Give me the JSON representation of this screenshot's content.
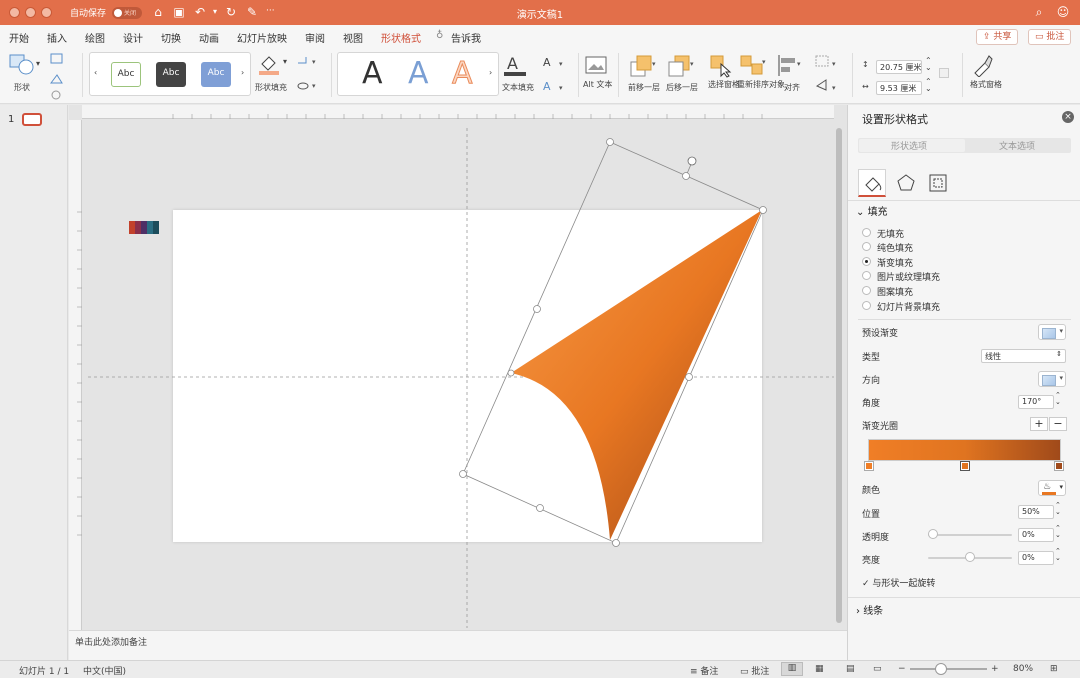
{
  "titlebar": {
    "autosave_label": "自动保存",
    "toggle_label": "关闭",
    "doc_title": "演示文稿1",
    "more": "···"
  },
  "menu": {
    "tabs": [
      "开始",
      "插入",
      "绘图",
      "设计",
      "切换",
      "动画",
      "幻灯片放映",
      "审阅",
      "视图",
      "形状格式",
      "告诉我"
    ],
    "active": "形状格式",
    "share_label": "共享",
    "comment_label": "批注"
  },
  "ribbon": {
    "shape_label": "形状",
    "shape_fill_label": "形状填充",
    "style_samples": [
      "Abc",
      "Abc",
      "Abc"
    ],
    "wordart_samples": [
      "A",
      "A",
      "A"
    ],
    "text_fill_label": "文本填充",
    "alt_text_label": "Alt 文本",
    "bring_forward_label": "前移一层",
    "send_backward_label": "后移一层",
    "selection_pane_label": "选择窗格",
    "reorder_label": "重新排序对象",
    "align_label": "对齐",
    "height_value": "20.75 厘米",
    "width_value": "9.53 厘米",
    "format_pane_label": "格式窗格"
  },
  "slides": {
    "current_number": "1"
  },
  "notes": {
    "placeholder": "单击此处添加备注"
  },
  "panel": {
    "title": "设置形状格式",
    "tab_shape_options": "形状选项",
    "tab_text_options": "文本选项",
    "fill_section": "填充",
    "fill_options": [
      "无填充",
      "纯色填充",
      "渐变填充",
      "图片或纹理填充",
      "图案填充",
      "幻灯片背景填充"
    ],
    "fill_selected": "渐变填充",
    "preset_label": "预设渐变",
    "type_label": "类型",
    "type_value": "线性",
    "direction_label": "方向",
    "angle_label": "角度",
    "angle_value": "170°",
    "stops_label": "渐变光圈",
    "color_label": "颜色",
    "position_label": "位置",
    "position_value": "50%",
    "transparency_label": "透明度",
    "transparency_value": "0%",
    "transparency_level": 0,
    "brightness_label": "亮度",
    "brightness_value": "0%",
    "brightness_level": 0,
    "rotate_with_shape_label": "与形状一起旋转",
    "rotate_with_shape": true,
    "line_section": "线条",
    "gradient_colors": [
      "#f07e26",
      "#e07420",
      "#a04a1a"
    ]
  },
  "status": {
    "slide_info": "幻灯片 1 / 1",
    "language": "中文(中国)",
    "notes_label": "备注",
    "comments_label": "批注",
    "zoom_value": "80%",
    "zoom_level": 0.8
  },
  "colors": {
    "accent": "#e26f4a",
    "active_tab": "#d0503a",
    "shape_light": "#f48a2e",
    "shape_dark": "#a94c1a"
  }
}
